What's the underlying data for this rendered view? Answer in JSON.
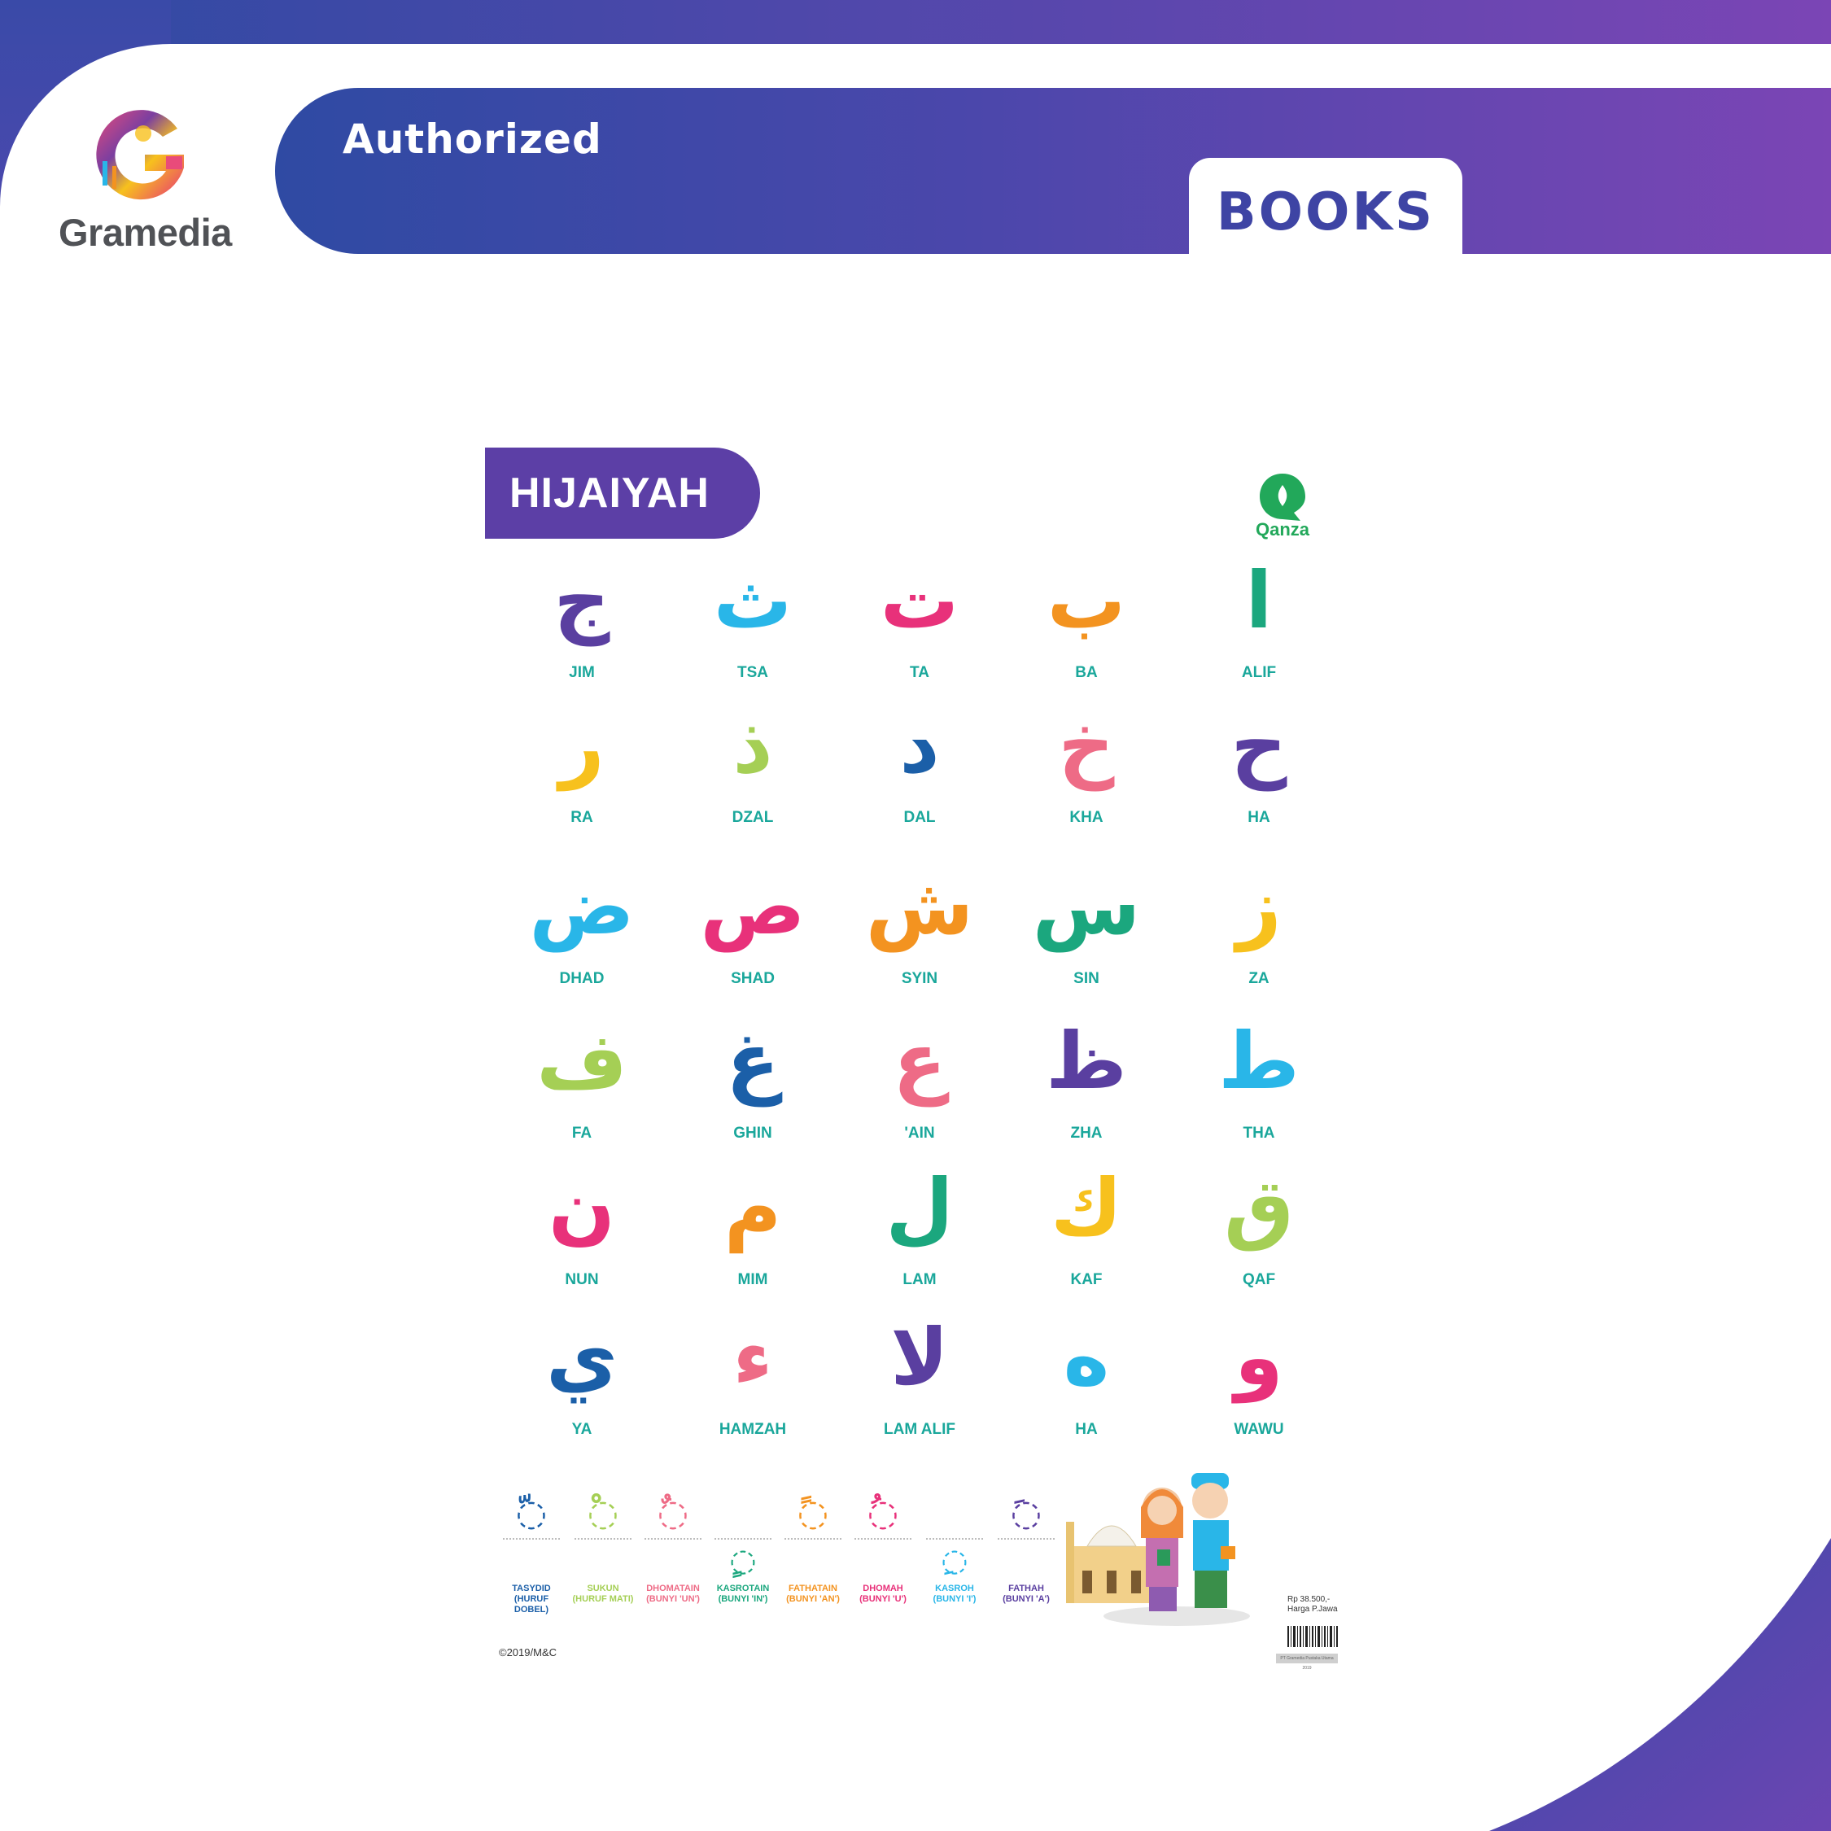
{
  "header": {
    "brand": "Gramedia",
    "authorized_label": "Authorized",
    "books_label": "BOOKS"
  },
  "poster": {
    "title": "HIJAIYAH",
    "publisher": "Qanza",
    "copyright": "©2019/M&C",
    "price_lines": [
      "Rp 38.500,-",
      "Harga P.Jawa"
    ],
    "barcode_caption": "PT Gramedia Pustaka Utama 2019",
    "letters": [
      {
        "arabic": "ج",
        "name": "JIM",
        "color": "#5a3fa0"
      },
      {
        "arabic": "ث",
        "name": "TSA",
        "color": "#29b6e8"
      },
      {
        "arabic": "ت",
        "name": "TA",
        "color": "#e8317a"
      },
      {
        "arabic": "ب",
        "name": "BA",
        "color": "#f39320"
      },
      {
        "arabic": "ا",
        "name": "ALIF",
        "color": "#1ba77e"
      },
      {
        "arabic": "ر",
        "name": "RA",
        "color": "#f7c11d"
      },
      {
        "arabic": "ذ",
        "name": "DZAL",
        "color": "#a5cf55"
      },
      {
        "arabic": "د",
        "name": "DAL",
        "color": "#1b5fa8"
      },
      {
        "arabic": "خ",
        "name": "KHA",
        "color": "#ee6b86"
      },
      {
        "arabic": "ح",
        "name": "HA",
        "color": "#5a3fa0"
      },
      {
        "arabic": "ض",
        "name": "DHAD",
        "color": "#29b6e8"
      },
      {
        "arabic": "ص",
        "name": "SHAD",
        "color": "#e8317a"
      },
      {
        "arabic": "ش",
        "name": "SYIN",
        "color": "#f39320"
      },
      {
        "arabic": "س",
        "name": "SIN",
        "color": "#1ba77e"
      },
      {
        "arabic": "ز",
        "name": "ZA",
        "color": "#f7c11d"
      },
      {
        "arabic": "ف",
        "name": "FA",
        "color": "#a5cf55"
      },
      {
        "arabic": "غ",
        "name": "GHIN",
        "color": "#1b5fa8"
      },
      {
        "arabic": "ع",
        "name": "'AIN",
        "color": "#ee6b86"
      },
      {
        "arabic": "ظ",
        "name": "ZHA",
        "color": "#5a3fa0"
      },
      {
        "arabic": "ط",
        "name": "THA",
        "color": "#29b6e8"
      },
      {
        "arabic": "ن",
        "name": "NUN",
        "color": "#e8317a"
      },
      {
        "arabic": "م",
        "name": "MIM",
        "color": "#f39320"
      },
      {
        "arabic": "ل",
        "name": "LAM",
        "color": "#1ba77e"
      },
      {
        "arabic": "ك",
        "name": "KAF",
        "color": "#f7c11d"
      },
      {
        "arabic": "ق",
        "name": "QAF",
        "color": "#a5cf55"
      },
      {
        "arabic": "ي",
        "name": "YA",
        "color": "#1b5fa8"
      },
      {
        "arabic": "ء",
        "name": "HAMZAH",
        "color": "#ee6b86"
      },
      {
        "arabic": "لا",
        "name": "LAM ALIF",
        "color": "#5a3fa0"
      },
      {
        "arabic": "ه",
        "name": "HA",
        "color": "#29b6e8"
      },
      {
        "arabic": "و",
        "name": "WAWU",
        "color": "#e8317a"
      }
    ],
    "harakat": [
      {
        "mark": "ّ",
        "label1": "TASYDID",
        "label2": "(HURUF DOBEL)",
        "color": "#1b5fa8"
      },
      {
        "mark": "ْ",
        "label1": "SUKUN",
        "label2": "(HURUF MATI)",
        "color": "#a5cf55"
      },
      {
        "mark": "ٌ",
        "label1": "DHOMATAIN",
        "label2": "(BUNYI 'UN')",
        "color": "#ee6b86"
      },
      {
        "mark": "ٍ",
        "label1": "KASROTAIN",
        "label2": "(BUNYI 'IN')",
        "color": "#1ba77e"
      },
      {
        "mark": "ً",
        "label1": "FATHATAIN",
        "label2": "(BUNYI 'AN')",
        "color": "#f39320"
      },
      {
        "mark": "ُ",
        "label1": "DHOMAH",
        "label2": "(BUNYI 'U')",
        "color": "#e8317a"
      },
      {
        "mark": "ِ",
        "label1": "KASROH",
        "label2": "(BUNYI 'I')",
        "color": "#29b6e8"
      },
      {
        "mark": "َ",
        "label1": "FATHAH",
        "label2": "(BUNYI 'A')",
        "color": "#5a3fa0"
      }
    ]
  }
}
